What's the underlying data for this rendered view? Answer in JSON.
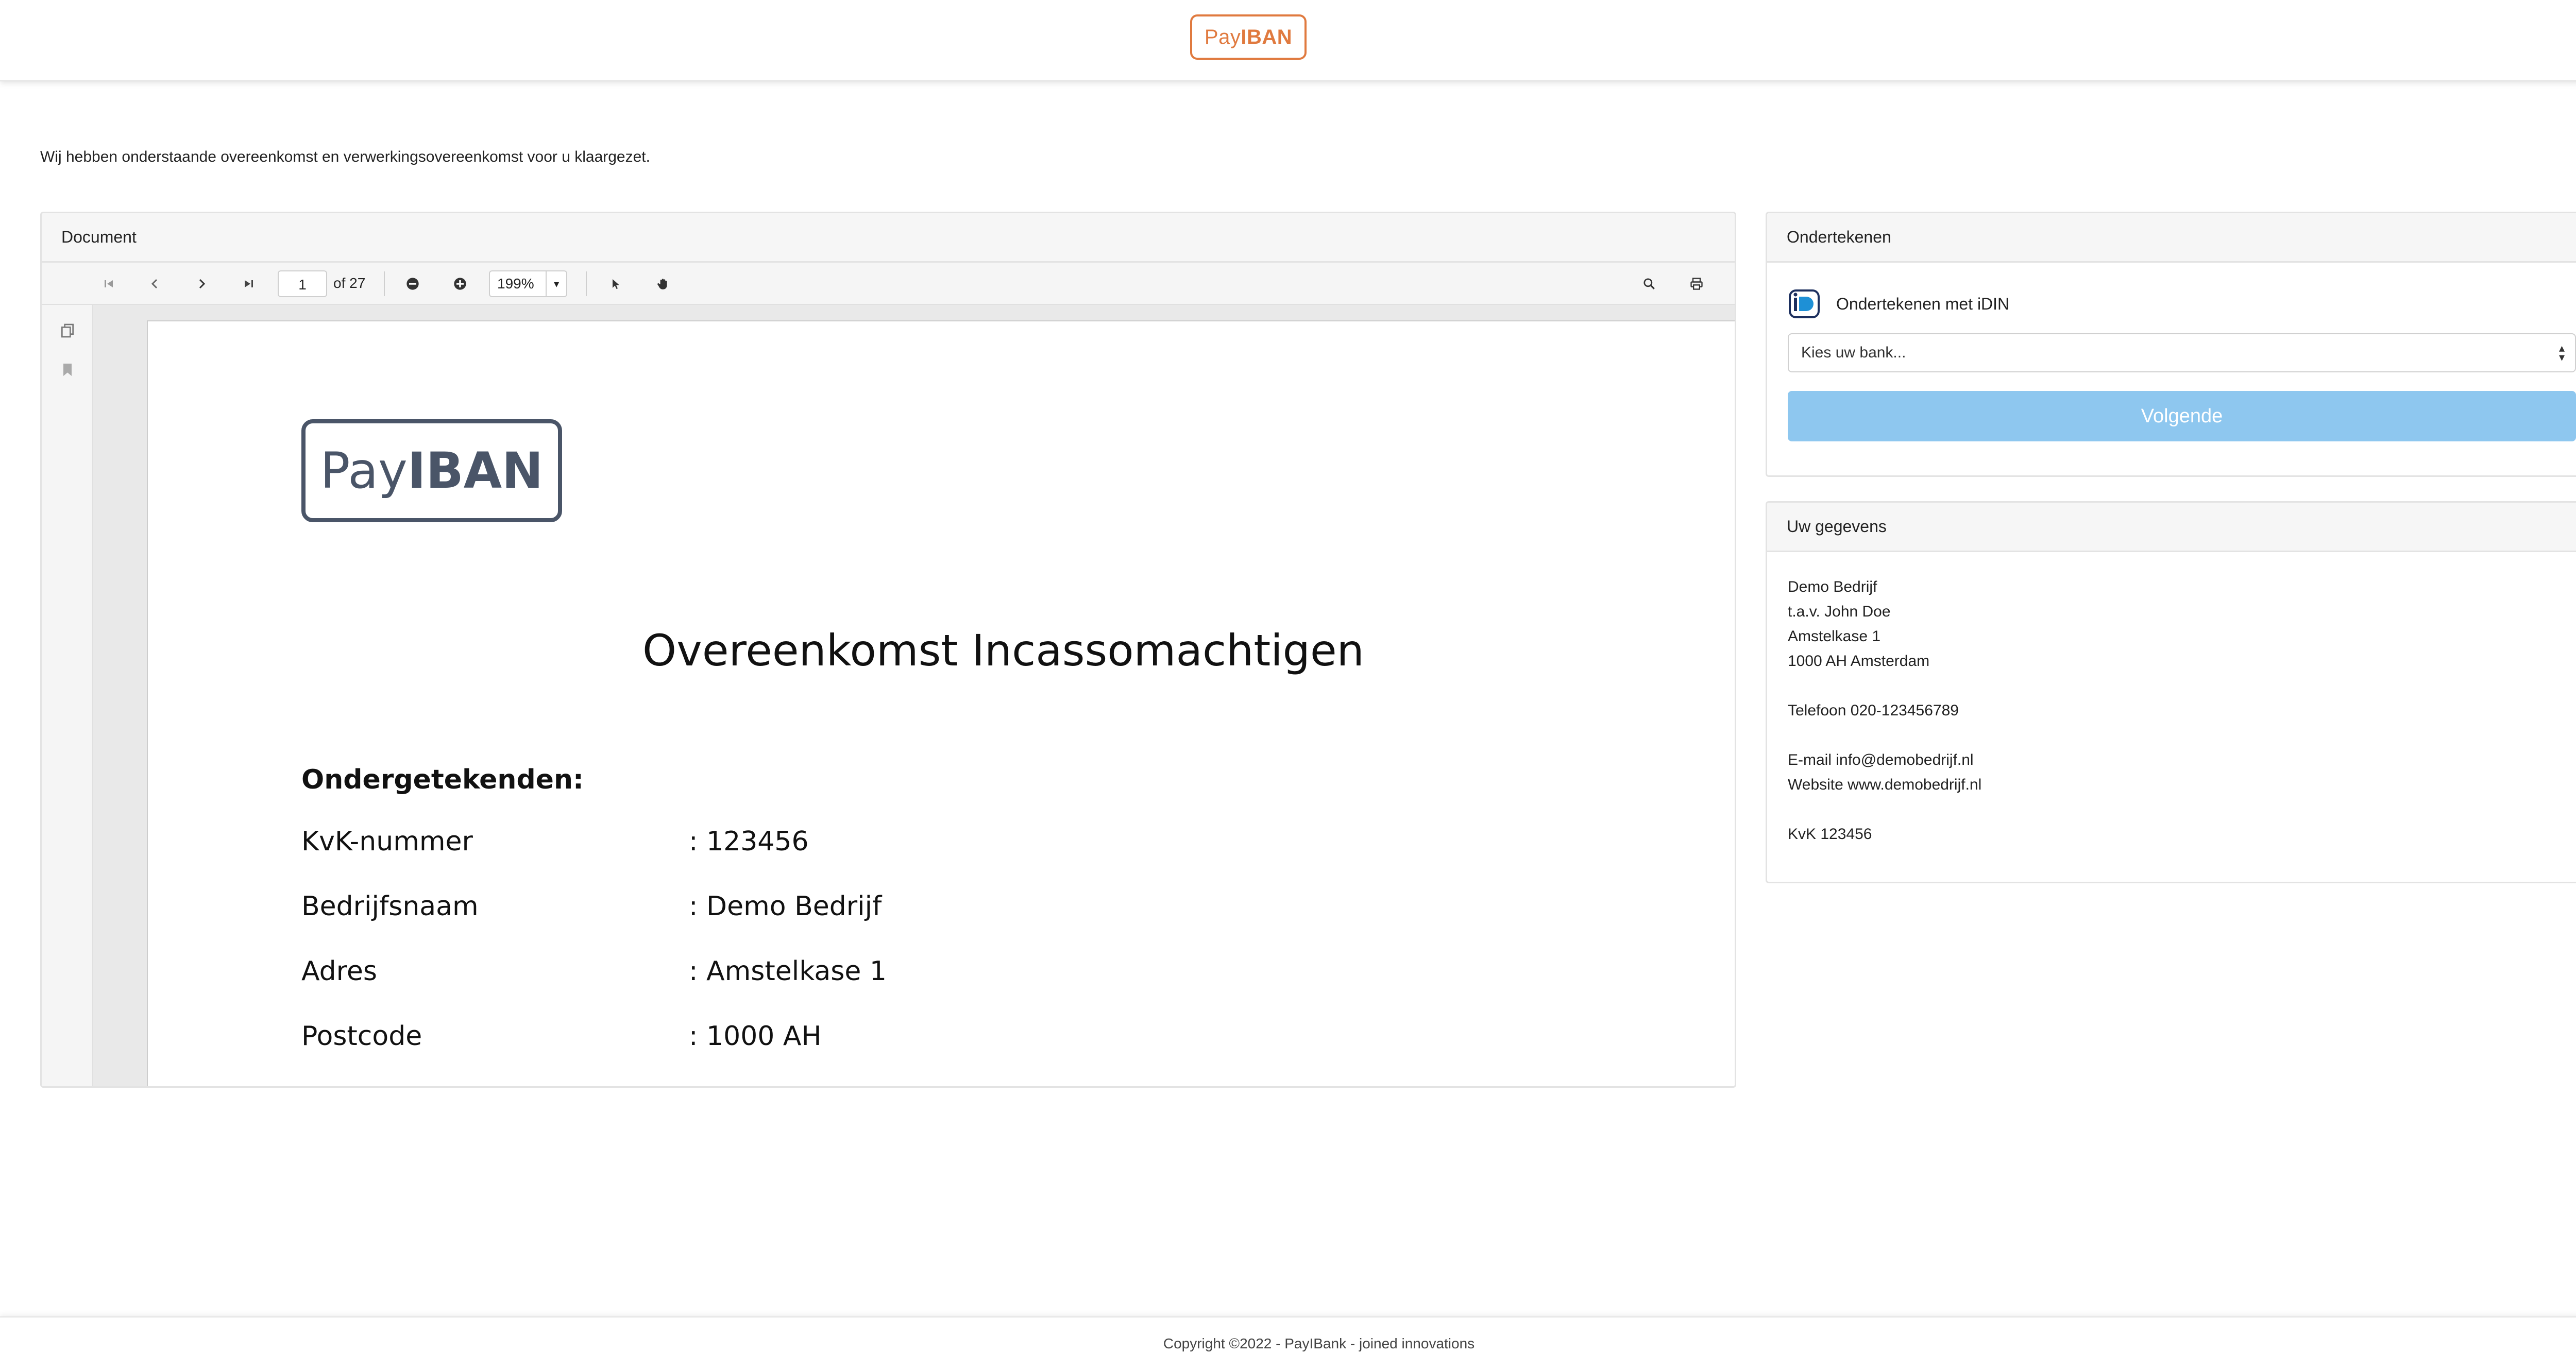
{
  "header": {
    "logo_pay": "Pay",
    "logo_iban": "IBAN"
  },
  "intro_text": "Wij hebben onderstaande overeenkomst en verwerkingsovereenkomst voor u klaargezet.",
  "document_panel": {
    "title": "Document",
    "toolbar": {
      "page_value": "1",
      "page_total": "of 27",
      "zoom": "199%"
    },
    "page": {
      "logo_pay": "Pay",
      "logo_iban": "IBAN",
      "title": "Overeenkomst Incassomachtigen",
      "subtitle": "Ondergetekenden:",
      "rows": [
        {
          "label": "KvK-nummer",
          "value": ": 123456"
        },
        {
          "label": "Bedrijfsnaam",
          "value": ": Demo Bedrijf"
        },
        {
          "label": "Adres",
          "value": ": Amstelkase 1"
        },
        {
          "label": "Postcode",
          "value": ": 1000 AH"
        }
      ]
    }
  },
  "sign_panel": {
    "title": "Ondertekenen",
    "idin_label": "Ondertekenen met iDIN",
    "bank_select": "Kies uw bank...",
    "next_button": "Volgende"
  },
  "data_panel": {
    "title": "Uw gegevens",
    "company": "Demo Bedrijf",
    "attention": "t.a.v. John Doe",
    "street": "Amstelkase 1",
    "city": "1000 AH Amsterdam",
    "phone": "Telefoon 020-123456789",
    "email": "E-mail info@demobedrijf.nl",
    "website": "Website www.demobedrijf.nl",
    "kvk": "KvK 123456"
  },
  "footer": {
    "copyright": "Copyright ©2022 - PayIBank - joined innovations"
  },
  "colors": {
    "brand_orange": "#e07a3f",
    "button_blue": "#8ec7ef",
    "doc_logo": "#4a5568"
  }
}
